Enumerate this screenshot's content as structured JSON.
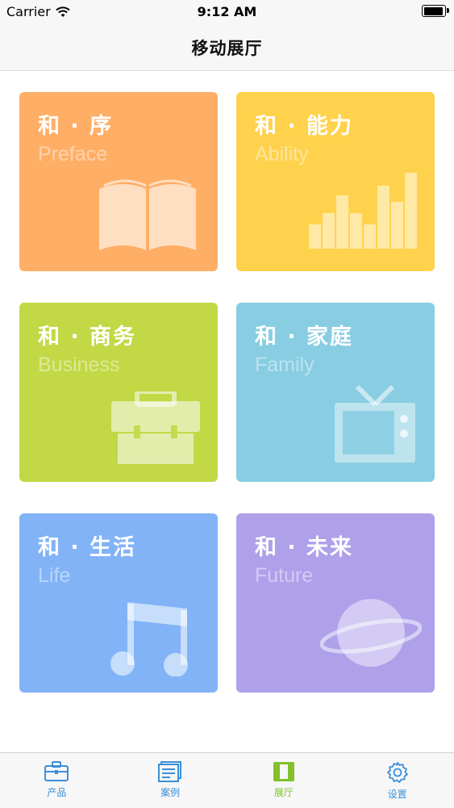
{
  "status_bar": {
    "carrier": "Carrier",
    "time": "9:12 AM"
  },
  "nav": {
    "title": "移动展厅"
  },
  "tiles": [
    {
      "title": "和 · 序",
      "subtitle": "Preface",
      "color": "#FFAE66",
      "icon": "open-book-icon"
    },
    {
      "title": "和 · 能力",
      "subtitle": "Ability",
      "color": "#FFD24D",
      "icon": "bar-chart-icon"
    },
    {
      "title": "和 · 商务",
      "subtitle": "Business",
      "color": "#C2D845",
      "icon": "briefcase-icon"
    },
    {
      "title": "和 · 家庭",
      "subtitle": "Family",
      "color": "#88CDE2",
      "icon": "tv-icon"
    },
    {
      "title": "和 · 生活",
      "subtitle": "Life",
      "color": "#82B3F7",
      "icon": "music-note-icon"
    },
    {
      "title": "和 · 未来",
      "subtitle": "Future",
      "color": "#AFA0EA",
      "icon": "planet-icon"
    }
  ],
  "tab_bar": {
    "items": [
      {
        "label": "产品",
        "icon": "briefcase-icon",
        "active": false
      },
      {
        "label": "案例",
        "icon": "document-list-icon",
        "active": false
      },
      {
        "label": "展厅",
        "icon": "gallery-icon",
        "active": true
      },
      {
        "label": "设置",
        "icon": "gear-icon",
        "active": false
      }
    ],
    "colors": {
      "default": "#3A8FD9",
      "active": "#83C02A"
    }
  }
}
